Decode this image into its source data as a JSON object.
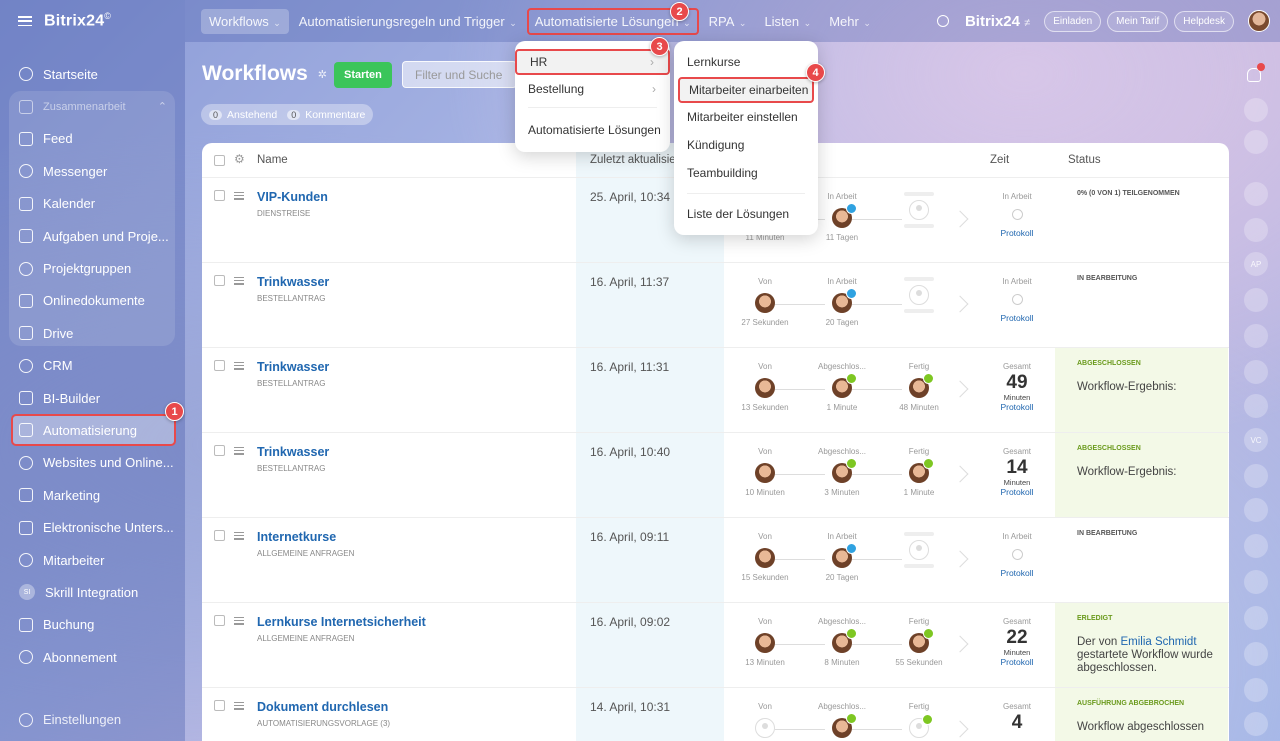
{
  "app": {
    "logo": "Bitrix24",
    "logo_mark": "©"
  },
  "sidebar": {
    "items": [
      {
        "label": "Startseite",
        "icon": "home-icon"
      },
      {
        "label": "Zusammenarbeit",
        "icon": "collab-icon",
        "group": true
      },
      {
        "label": "Feed",
        "icon": "feed-icon"
      },
      {
        "label": "Messenger",
        "icon": "chat-icon"
      },
      {
        "label": "Kalender",
        "icon": "calendar-icon"
      },
      {
        "label": "Aufgaben und Proje...",
        "icon": "tasks-icon"
      },
      {
        "label": "Projektgruppen",
        "icon": "groups-icon"
      },
      {
        "label": "Onlinedokumente",
        "icon": "docs-icon"
      },
      {
        "label": "Drive",
        "icon": "drive-icon"
      },
      {
        "label": "CRM",
        "icon": "crm-icon"
      },
      {
        "label": "BI-Builder",
        "icon": "chart-icon"
      },
      {
        "label": "Automatisierung",
        "icon": "robot-icon",
        "active": true
      },
      {
        "label": "Websites und Online...",
        "icon": "cart-icon"
      },
      {
        "label": "Marketing",
        "icon": "target-icon"
      },
      {
        "label": "Elektronische Unters...",
        "icon": "signature-icon"
      },
      {
        "label": "Mitarbeiter",
        "icon": "employee-icon"
      },
      {
        "label": "Skrill Integration",
        "icon": "app-badge",
        "badge": "SI"
      },
      {
        "label": "Buchung",
        "icon": "booking-icon"
      },
      {
        "label": "Abonnement",
        "icon": "subscription-icon"
      }
    ],
    "settings": "Einstellungen"
  },
  "topbar": {
    "tabs": [
      {
        "label": "Workflows",
        "selected": true
      },
      {
        "label": "Automatisierungsregeln und Trigger"
      },
      {
        "label": "Automatisierte Lösungen",
        "boxed": true
      },
      {
        "label": "RPA"
      },
      {
        "label": "Listen"
      },
      {
        "label": "Mehr"
      }
    ],
    "brand": "Bitrix24",
    "brand_suffix": "≠",
    "invite": "Einladen",
    "plan": "Mein Tarif",
    "help": "Helpdesk"
  },
  "page": {
    "title": "Workflows",
    "start_button": "Starten",
    "filter_placeholder": "Filter und Suche",
    "counters": [
      {
        "count": "0",
        "label": "Anstehend"
      },
      {
        "count": "0",
        "label": "Kommentare"
      }
    ]
  },
  "table": {
    "headers": {
      "name": "Name",
      "updated": "Zuletzt aktualisie",
      "time": "Zeit",
      "status": "Status"
    },
    "rows": [
      {
        "name": "VIP-Kunden",
        "type": "Dienstreise",
        "date": "25. April, 10:34",
        "stages": [
          {
            "label": "",
            "duration": "11 Minuten",
            "face": "hidden"
          },
          {
            "label": "In Arbeit",
            "duration": "11 Tagen",
            "face": "person",
            "badge": "prog"
          },
          {
            "label": "",
            "duration": "",
            "face": "empty"
          }
        ],
        "time": {
          "label": "In Arbeit",
          "value": "",
          "unit": "",
          "link": "Protokoll"
        },
        "status": {
          "code": "0% (0 von 1) teilgenommen",
          "text": "",
          "done": false
        }
      },
      {
        "name": "Trinkwasser",
        "type": "Bestellantrag",
        "date": "16. April, 11:37",
        "stages": [
          {
            "label": "Von",
            "duration": "27 Sekunden",
            "face": "person"
          },
          {
            "label": "In Arbeit",
            "duration": "20 Tagen",
            "face": "person",
            "badge": "prog"
          },
          {
            "label": "",
            "duration": "",
            "face": "empty"
          }
        ],
        "time": {
          "label": "In Arbeit",
          "value": "",
          "unit": "",
          "link": "Protokoll"
        },
        "status": {
          "code": "In Bearbeitung",
          "text": "",
          "done": false
        }
      },
      {
        "name": "Trinkwasser",
        "type": "Bestellantrag",
        "date": "16. April, 11:31",
        "stages": [
          {
            "label": "Von",
            "duration": "13 Sekunden",
            "face": "person"
          },
          {
            "label": "Abgeschlos...",
            "duration": "1 Minute",
            "face": "person",
            "badge": "ok"
          },
          {
            "label": "Fertig",
            "duration": "48 Minuten",
            "face": "person",
            "badge": "ok"
          }
        ],
        "time": {
          "label": "Gesamt",
          "value": "49",
          "unit": "Minuten",
          "link": "Protokoll"
        },
        "status": {
          "code": "Abgeschlossen",
          "text": "Workflow-Ergebnis:",
          "done": true
        }
      },
      {
        "name": "Trinkwasser",
        "type": "Bestellantrag",
        "date": "16. April, 10:40",
        "stages": [
          {
            "label": "Von",
            "duration": "10 Minuten",
            "face": "person"
          },
          {
            "label": "Abgeschlos...",
            "duration": "3 Minuten",
            "face": "person",
            "badge": "ok"
          },
          {
            "label": "Fertig",
            "duration": "1 Minute",
            "face": "person",
            "badge": "ok"
          }
        ],
        "time": {
          "label": "Gesamt",
          "value": "14",
          "unit": "Minuten",
          "link": "Protokoll"
        },
        "status": {
          "code": "Abgeschlossen",
          "text": "Workflow-Ergebnis:",
          "done": true
        }
      },
      {
        "name": "Internetkurse",
        "type": "Allgemeine Anfragen",
        "date": "16. April, 09:11",
        "stages": [
          {
            "label": "Von",
            "duration": "15 Sekunden",
            "face": "person"
          },
          {
            "label": "In Arbeit",
            "duration": "20 Tagen",
            "face": "person",
            "badge": "prog"
          },
          {
            "label": "",
            "duration": "",
            "face": "empty"
          }
        ],
        "time": {
          "label": "In Arbeit",
          "value": "",
          "unit": "",
          "link": "Protokoll"
        },
        "status": {
          "code": "In Bearbeitung",
          "text": "",
          "done": false
        }
      },
      {
        "name": "Lernkurse Internetsicherheit",
        "type": "Allgemeine Anfragen",
        "date": "16. April, 09:02",
        "stages": [
          {
            "label": "Von",
            "duration": "13 Minuten",
            "face": "person"
          },
          {
            "label": "Abgeschlos...",
            "duration": "8 Minuten",
            "face": "person",
            "badge": "ok"
          },
          {
            "label": "Fertig",
            "duration": "55 Sekunden",
            "face": "person",
            "badge": "ok"
          }
        ],
        "time": {
          "label": "Gesamt",
          "value": "22",
          "unit": "Minuten",
          "link": "Protokoll"
        },
        "status": {
          "code": "Erledigt",
          "text_pre": "Der von ",
          "text_link": "Emilia Schmidt",
          "text_post": " gestartete Workflow wurde abgeschlossen.",
          "done": true
        }
      },
      {
        "name": "Dokument durchlesen",
        "type": "Automatisierungsvorlage (3)",
        "date": "14. April, 10:31",
        "stages": [
          {
            "label": "Von",
            "duration": "",
            "face": "empty"
          },
          {
            "label": "Abgeschlos...",
            "duration": "",
            "face": "person",
            "badge": "ok"
          },
          {
            "label": "Fertig",
            "duration": "",
            "face": "empty",
            "badge": "ok"
          }
        ],
        "time": {
          "label": "Gesamt",
          "value": "4",
          "unit": "",
          "link": ""
        },
        "status": {
          "code": "Ausführung abgebrochen",
          "text": "Workflow abgeschlossen",
          "done": true
        }
      }
    ]
  },
  "menus": {
    "solutions": [
      {
        "label": "HR",
        "has_sub": true
      },
      {
        "label": "Bestellung",
        "has_sub": true
      },
      {
        "label": "Automatisierte Lösungen",
        "has_sub": false
      }
    ],
    "hr": [
      {
        "label": "Lernkurse"
      },
      {
        "label": "Mitarbeiter einarbeiten"
      },
      {
        "label": "Mitarbeiter einstellen"
      },
      {
        "label": "Kündigung"
      },
      {
        "label": "Teambuilding"
      },
      {
        "label": "Liste der Lösungen"
      }
    ]
  },
  "steps": [
    "1",
    "2",
    "3",
    "4"
  ],
  "rail": {
    "badges": [
      "AP",
      "VC"
    ],
    "notifications_count": "1"
  },
  "colors": {
    "accent_red": "#e8494b",
    "start_green": "#3bc55a",
    "link_blue": "#2067b0",
    "done_bg": "#f3f9e7"
  }
}
